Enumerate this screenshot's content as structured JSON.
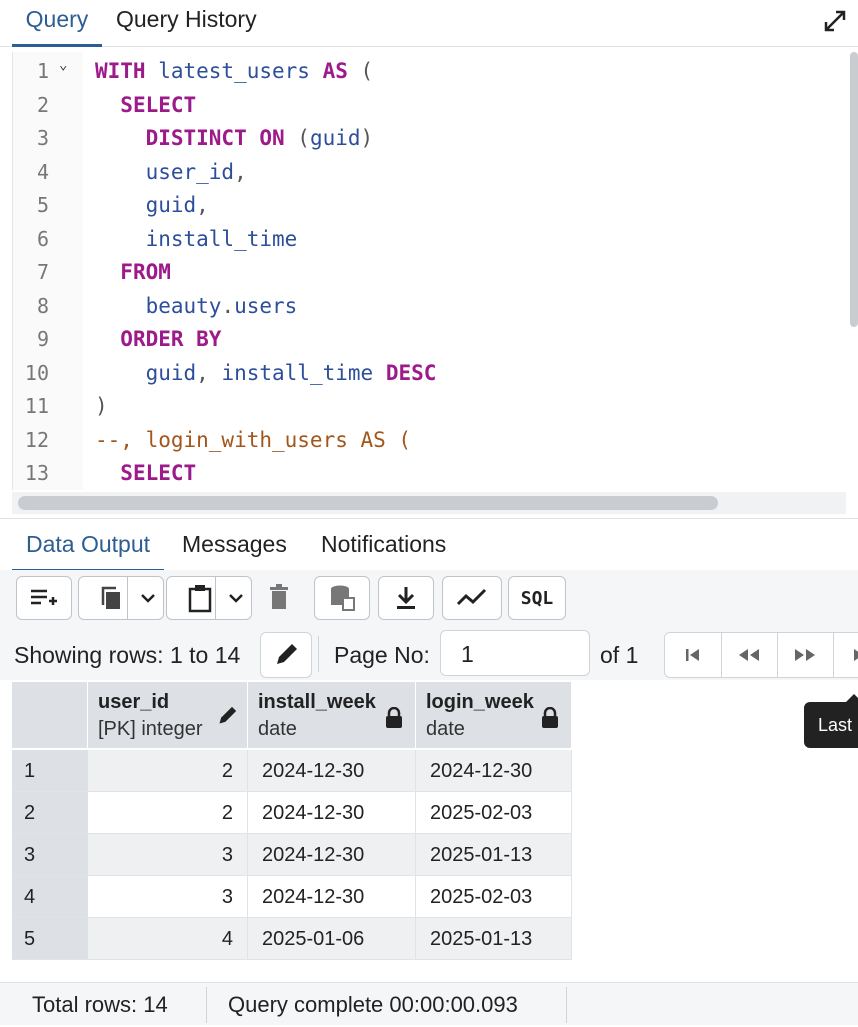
{
  "tabs": {
    "query": "Query",
    "history": "Query History"
  },
  "editor": {
    "lines": [
      {
        "n": "1",
        "fold": true,
        "segs": [
          [
            "kw",
            "WITH "
          ],
          [
            "id",
            "latest_users "
          ],
          [
            "kw",
            "AS "
          ],
          [
            "pn",
            "("
          ]
        ]
      },
      {
        "n": "2",
        "segs": [
          [
            "pn",
            "  "
          ],
          [
            "kw",
            "SELECT"
          ]
        ]
      },
      {
        "n": "3",
        "segs": [
          [
            "pn",
            "    "
          ],
          [
            "kw",
            "DISTINCT ON "
          ],
          [
            "pn",
            "("
          ],
          [
            "id",
            "guid"
          ],
          [
            "pn",
            ")"
          ]
        ]
      },
      {
        "n": "4",
        "segs": [
          [
            "pn",
            "    "
          ],
          [
            "id",
            "user_id"
          ],
          [
            "pn",
            ","
          ]
        ]
      },
      {
        "n": "5",
        "segs": [
          [
            "pn",
            "    "
          ],
          [
            "id",
            "guid"
          ],
          [
            "pn",
            ","
          ]
        ]
      },
      {
        "n": "6",
        "segs": [
          [
            "pn",
            "    "
          ],
          [
            "id",
            "install_time"
          ]
        ]
      },
      {
        "n": "7",
        "segs": [
          [
            "pn",
            "  "
          ],
          [
            "kw",
            "FROM"
          ]
        ]
      },
      {
        "n": "8",
        "segs": [
          [
            "pn",
            "    "
          ],
          [
            "id",
            "beauty"
          ],
          [
            "pn",
            "."
          ],
          [
            "id",
            "users"
          ]
        ]
      },
      {
        "n": "9",
        "segs": [
          [
            "pn",
            "  "
          ],
          [
            "kw",
            "ORDER BY"
          ]
        ]
      },
      {
        "n": "10",
        "segs": [
          [
            "pn",
            "    "
          ],
          [
            "id",
            "guid"
          ],
          [
            "pn",
            ", "
          ],
          [
            "id",
            "install_time "
          ],
          [
            "kw",
            "DESC"
          ]
        ]
      },
      {
        "n": "11",
        "segs": [
          [
            "pn",
            ")"
          ]
        ]
      },
      {
        "n": "12",
        "segs": [
          [
            "cm",
            "--, login_with_users AS ("
          ]
        ]
      },
      {
        "n": "13",
        "segs": [
          [
            "pn",
            "  "
          ],
          [
            "kw",
            "SELECT"
          ]
        ]
      }
    ]
  },
  "output_tabs": {
    "data": "Data Output",
    "messages": "Messages",
    "notifications": "Notifications"
  },
  "toolbar": {
    "sql_label": "SQL"
  },
  "pager": {
    "showing": "Showing rows: 1 to 14",
    "page_label": "Page No:",
    "page_value": "1",
    "of_label": "of 1"
  },
  "tooltip": {
    "text": "Last"
  },
  "grid": {
    "columns": [
      {
        "name": "user_id",
        "type": "[PK] integer",
        "icon": "pencil-icon"
      },
      {
        "name": "install_week",
        "type": "date",
        "icon": "lock-icon"
      },
      {
        "name": "login_week",
        "type": "date",
        "icon": "lock-icon"
      }
    ],
    "rows": [
      {
        "rn": "1",
        "user_id": "2",
        "install_week": "2024-12-30",
        "login_week": "2024-12-30"
      },
      {
        "rn": "2",
        "user_id": "2",
        "install_week": "2024-12-30",
        "login_week": "2025-02-03"
      },
      {
        "rn": "3",
        "user_id": "3",
        "install_week": "2024-12-30",
        "login_week": "2025-01-13"
      },
      {
        "rn": "4",
        "user_id": "3",
        "install_week": "2024-12-30",
        "login_week": "2025-02-03"
      },
      {
        "rn": "5",
        "user_id": "4",
        "install_week": "2025-01-06",
        "login_week": "2025-01-13"
      }
    ]
  },
  "status": {
    "total": "Total rows: 14",
    "complete": "Query complete 00:00:00.093"
  }
}
